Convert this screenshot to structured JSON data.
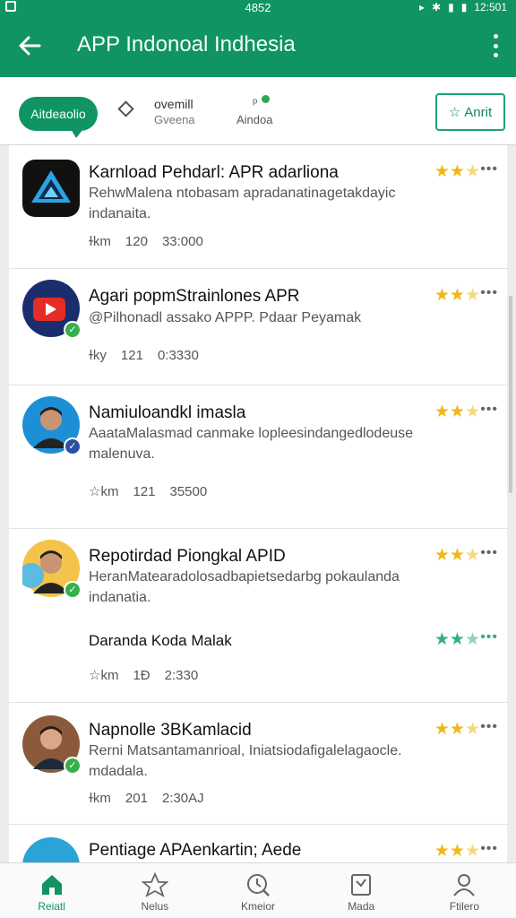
{
  "status_bar": {
    "time": "12:501",
    "center": "4852"
  },
  "app_bar": {
    "title": "APP Indonoal Indhesia",
    "back_icon": "back-arrow-icon",
    "menu_icon": "overflow-menu-icon"
  },
  "filters": {
    "chip_label": "Aitdeaolio",
    "item1_title": "ovemill",
    "item1_sub": "Gveena",
    "item2_sub": "Aindoa",
    "rate_label": "Anrit"
  },
  "apps": [
    {
      "name": "Karnload Pehdarl: APR adarliona",
      "desc": "RehwMalena ntobasam apradanatinagetakdayic indanaita.",
      "meta": [
        "ɫkm",
        "120",
        "33:000"
      ],
      "stars": 2,
      "color": "#1a1a1a"
    },
    {
      "name": "Agari popmStrainlones APR",
      "desc": "@Pilhonadl assako APPP. Pdaar Peyamak",
      "meta": [
        "ɫky",
        "121",
        "0:3330"
      ],
      "stars": 2,
      "color": "#1a2e6e"
    },
    {
      "name": "Namiuloandkl imasla",
      "desc": "AaataMalasmad canmake lopleesindangedlodeuse malenuva.",
      "meta": [
        "☆km",
        "121",
        "35500"
      ],
      "stars": 2,
      "color": "#1d8fd6"
    },
    {
      "name": "Repotirdad Piongkal APID",
      "desc": "HeranMatearadolosadbapietsedarbg pokaulanda indanatia.",
      "meta": [
        "☆km",
        "1Đ",
        "2:330"
      ],
      "sub_name": "Daranda Koda Malak",
      "stars": 2,
      "color": "#f4c44a"
    },
    {
      "name": "Napnolle 3BKamlacid",
      "desc": "Rerni Matsantamanrioal, Iniatsiodafigalelagaocle. mdadala.",
      "meta": [
        "ɫkm",
        "201",
        "2:30AJ"
      ],
      "stars": 2,
      "color": "#8a5a3a"
    },
    {
      "name": "Pentiage APAenkartin; Aede",
      "desc": "",
      "meta": [],
      "stars": 2,
      "color": "#2ba3d6"
    }
  ],
  "bottom_nav": [
    {
      "label": "Reiatl",
      "icon": "home-icon"
    },
    {
      "label": "Nelus",
      "icon": "star-icon"
    },
    {
      "label": "Kmeior",
      "icon": "clock-search-icon"
    },
    {
      "label": "Mada",
      "icon": "document-icon"
    },
    {
      "label": "Ftilero",
      "icon": "person-icon"
    }
  ]
}
